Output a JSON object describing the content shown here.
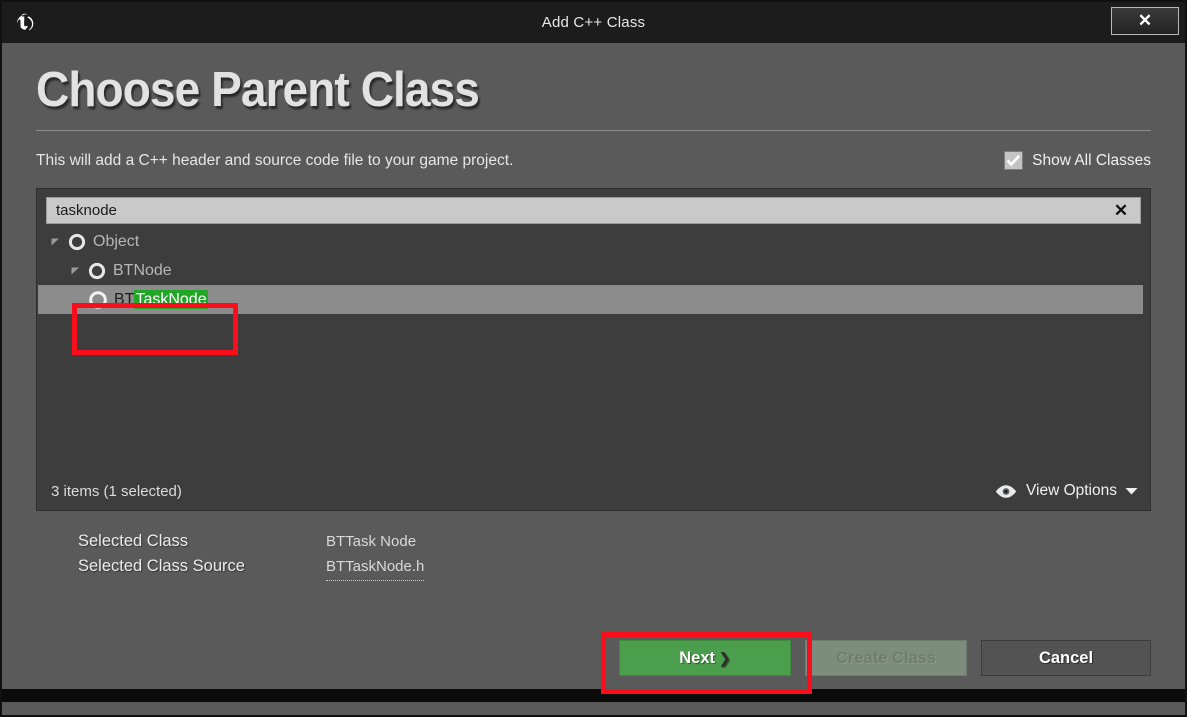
{
  "titlebar": {
    "logo_icon": "unreal-engine-logo",
    "title": "Add C++ Class",
    "close_label": "✕"
  },
  "header": {
    "page_title": "Choose Parent Class",
    "description": "This will add a C++ header and source code file to your game project.",
    "show_all_classes": {
      "label": "Show All Classes",
      "checked": true,
      "check_icon": "check-icon"
    }
  },
  "search": {
    "value": "tasknode",
    "placeholder": "Search Classes",
    "clear_icon": "close-icon",
    "clear_label": "✕"
  },
  "tree": {
    "items": [
      {
        "label": "Object",
        "indent": 0,
        "expanded": true,
        "selected": false,
        "icon": "class-circle-icon",
        "expander_icon": "triangle-down-icon"
      },
      {
        "label": "BTNode",
        "indent": 1,
        "expanded": true,
        "selected": false,
        "icon": "class-circle-icon",
        "expander_icon": "triangle-down-icon"
      },
      {
        "label_prefix": "BT",
        "label_highlight": "TaskNode",
        "label": "BTTaskNode",
        "indent": 2,
        "expanded": false,
        "selected": true,
        "icon": "class-circle-icon",
        "expander_icon": "none"
      }
    ],
    "highlight_color": "#22a628",
    "selection_color": "#8c8c8c"
  },
  "panel_footer": {
    "items_count": "3 items (1 selected)",
    "view_options_label": "View Options",
    "eye_icon": "eye-icon",
    "chevron_icon": "chevron-down-icon"
  },
  "selected_info": {
    "class_label": "Selected Class",
    "class_value": "BTTask Node",
    "source_label": "Selected Class Source",
    "source_value": "BTTaskNode.h"
  },
  "buttons": {
    "next": {
      "label": "Next",
      "chevron": "❯",
      "color": "#4b9e4b",
      "enabled": true
    },
    "create_class": {
      "label": "Create Class",
      "enabled": false
    },
    "cancel": {
      "label": "Cancel",
      "enabled": true
    }
  },
  "annotations": [
    {
      "name": "tree-item-highlight-box",
      "color": "#fc0d1b"
    },
    {
      "name": "next-button-highlight-box",
      "color": "#fc0d1b"
    }
  ]
}
